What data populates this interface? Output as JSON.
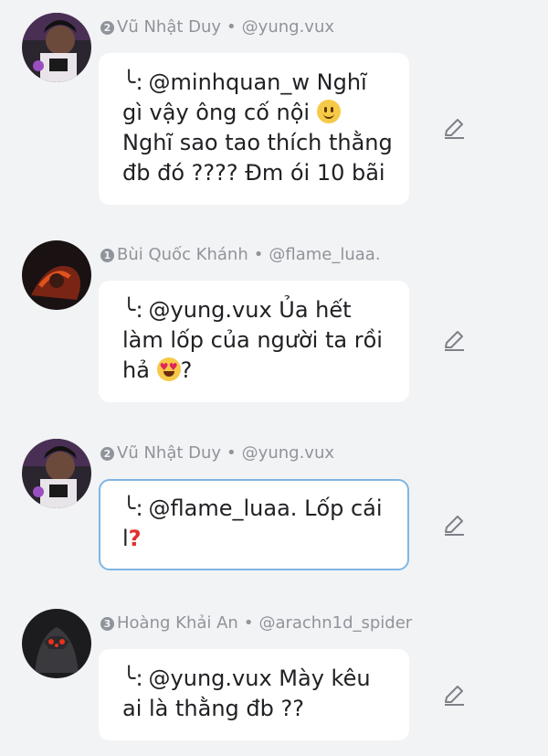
{
  "comments": [
    {
      "rank": "2",
      "name": "Vũ Nhật Duy",
      "separator": "•",
      "handle": "@yung.vux",
      "reply_mark": "╰:",
      "text_before": "@minhquan_w Nghĩ gì vậy ông cố nội",
      "emoji": "slightly-smiling-face",
      "text_after": "Nghĩ sao tao thích thằng đb đó ???? Đm ói 10 bãi"
    },
    {
      "rank": "1",
      "name": "Bùi Quốc Khánh",
      "separator": "•",
      "handle": "@flame_luaa.",
      "reply_mark": "╰:",
      "text_before": "@yung.vux Ủa hết làm lốp của người ta rồi hả",
      "emoji": "heart-eyes-face",
      "text_after": "?"
    },
    {
      "rank": "2",
      "name": "Vũ Nhật Duy",
      "separator": "•",
      "handle": "@yung.vux",
      "reply_mark": "╰:",
      "text_before": "@flame_luaa. Lốp cái l",
      "emoji": "red-question-mark",
      "emoji_char": "?",
      "text_after": "",
      "highlighted": true
    },
    {
      "rank": "3",
      "name": "Hoàng Khải An",
      "separator": "•",
      "handle": "@arachn1d_spider",
      "reply_mark": "╰:",
      "text_before": "@yung.vux Mày kêu ai là thằng đb ??",
      "emoji": "",
      "text_after": ""
    }
  ],
  "icons": {
    "edit": "pencil-icon"
  },
  "colors": {
    "background": "#f2f3f5",
    "bubble": "#ffffff",
    "meta_text": "#8f949a",
    "highlight_border": "#7fb6e4"
  }
}
